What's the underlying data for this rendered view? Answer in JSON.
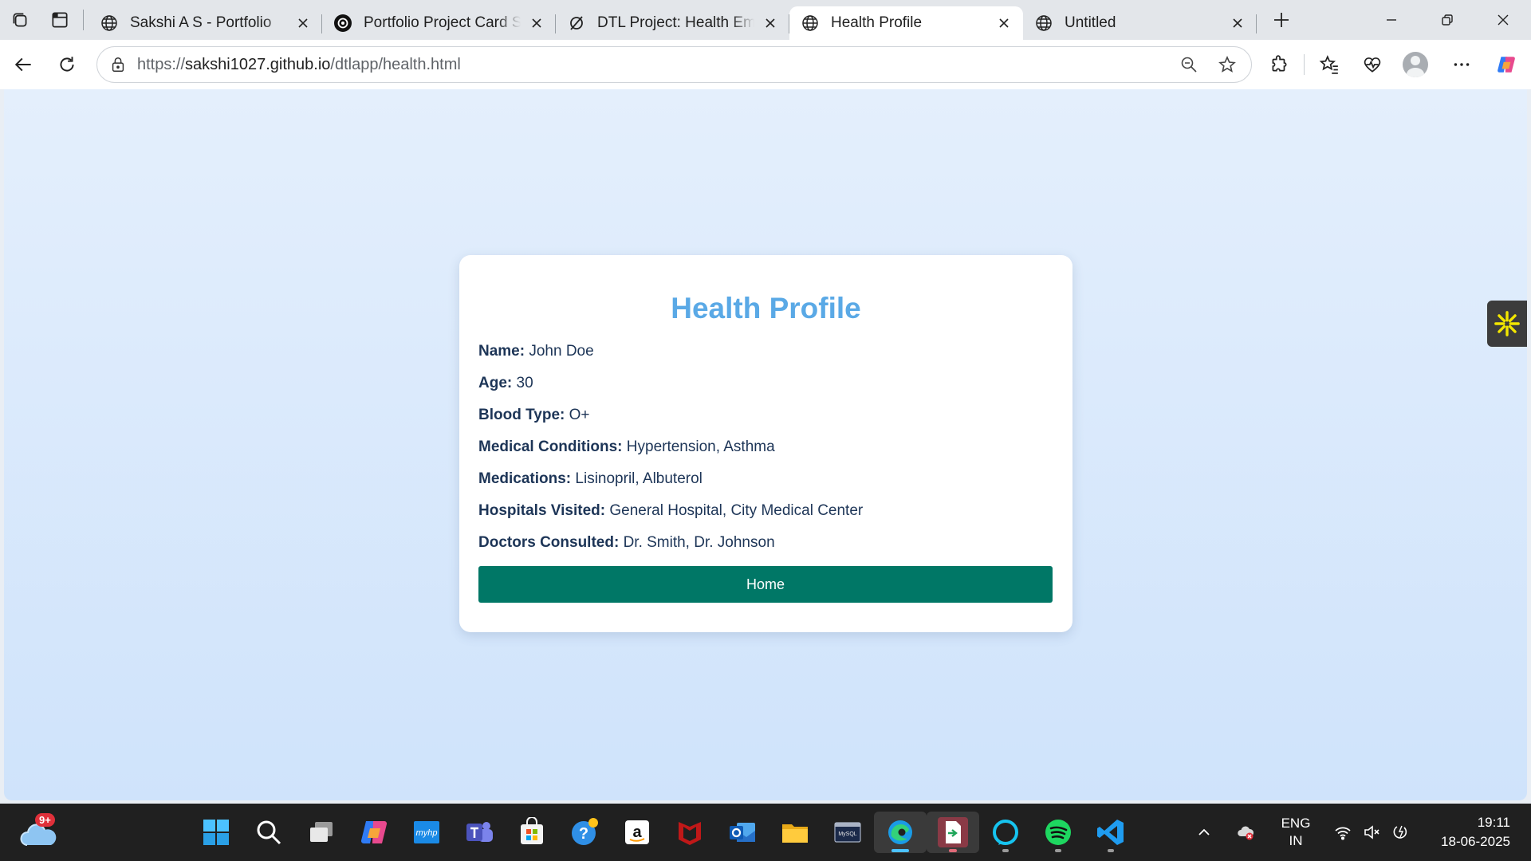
{
  "browser": {
    "tabs": [
      {
        "title": "Sakshi A S - Portfolio",
        "favicon": "globe-icon",
        "active": false
      },
      {
        "title": "Portfolio Project Card Set",
        "favicon": "chatgpt-icon",
        "active": false
      },
      {
        "title": "DTL Project: Health Emergency",
        "favicon": "compass-icon",
        "active": false
      },
      {
        "title": "Health Profile",
        "favicon": "globe-icon",
        "active": true
      },
      {
        "title": "Untitled",
        "favicon": "globe-icon",
        "active": false
      }
    ],
    "url_prefix": "https://",
    "url_host": "sakshi1027.github.io",
    "url_path": "/dtlapp/health.html"
  },
  "profile": {
    "heading": "Health Profile",
    "fields": [
      {
        "label": "Name:",
        "value": "John Doe"
      },
      {
        "label": "Age:",
        "value": "30"
      },
      {
        "label": "Blood Type:",
        "value": "O+"
      },
      {
        "label": "Medical Conditions:",
        "value": "Hypertension, Asthma"
      },
      {
        "label": "Medications:",
        "value": "Lisinopril, Albuterol"
      },
      {
        "label": "Hospitals Visited:",
        "value": "General Hospital, City Medical Center"
      },
      {
        "label": "Doctors Consulted:",
        "value": "Dr. Smith, Dr. Johnson"
      }
    ],
    "home_button": "Home"
  },
  "taskbar": {
    "weather_badge": "9+",
    "language_line1": "ENG",
    "language_line2": "IN",
    "time": "19:11",
    "date": "18-06-2025"
  },
  "colors": {
    "heading": "#5aa9e6",
    "text": "#1d3557",
    "button": "#007766",
    "background_top": "#e4effc",
    "background_bottom": "#cfe3fb"
  }
}
